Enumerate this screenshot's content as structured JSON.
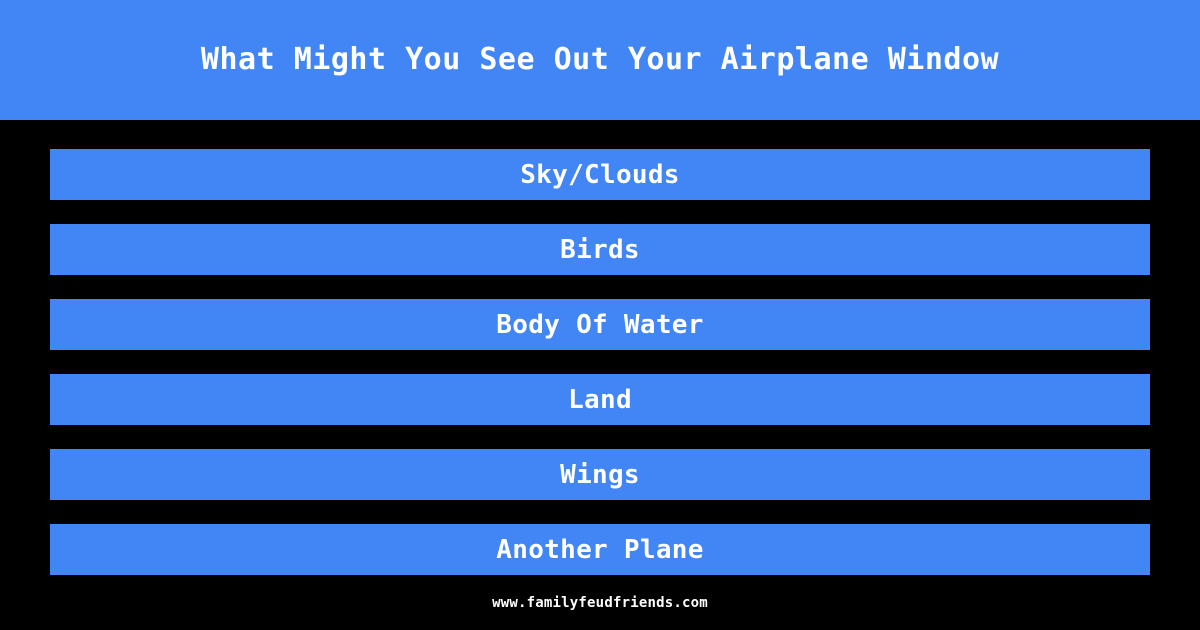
{
  "theme": {
    "accent_color": "#4285f4",
    "background_color": "#000000",
    "text_color": "#ffffff"
  },
  "header": {
    "title": "What Might You See Out Your Airplane Window"
  },
  "answers": [
    {
      "label": "Sky/Clouds"
    },
    {
      "label": "Birds"
    },
    {
      "label": "Body Of Water"
    },
    {
      "label": "Land"
    },
    {
      "label": "Wings"
    },
    {
      "label": "Another Plane"
    }
  ],
  "footer": {
    "url": "www.familyfeudfriends.com"
  }
}
